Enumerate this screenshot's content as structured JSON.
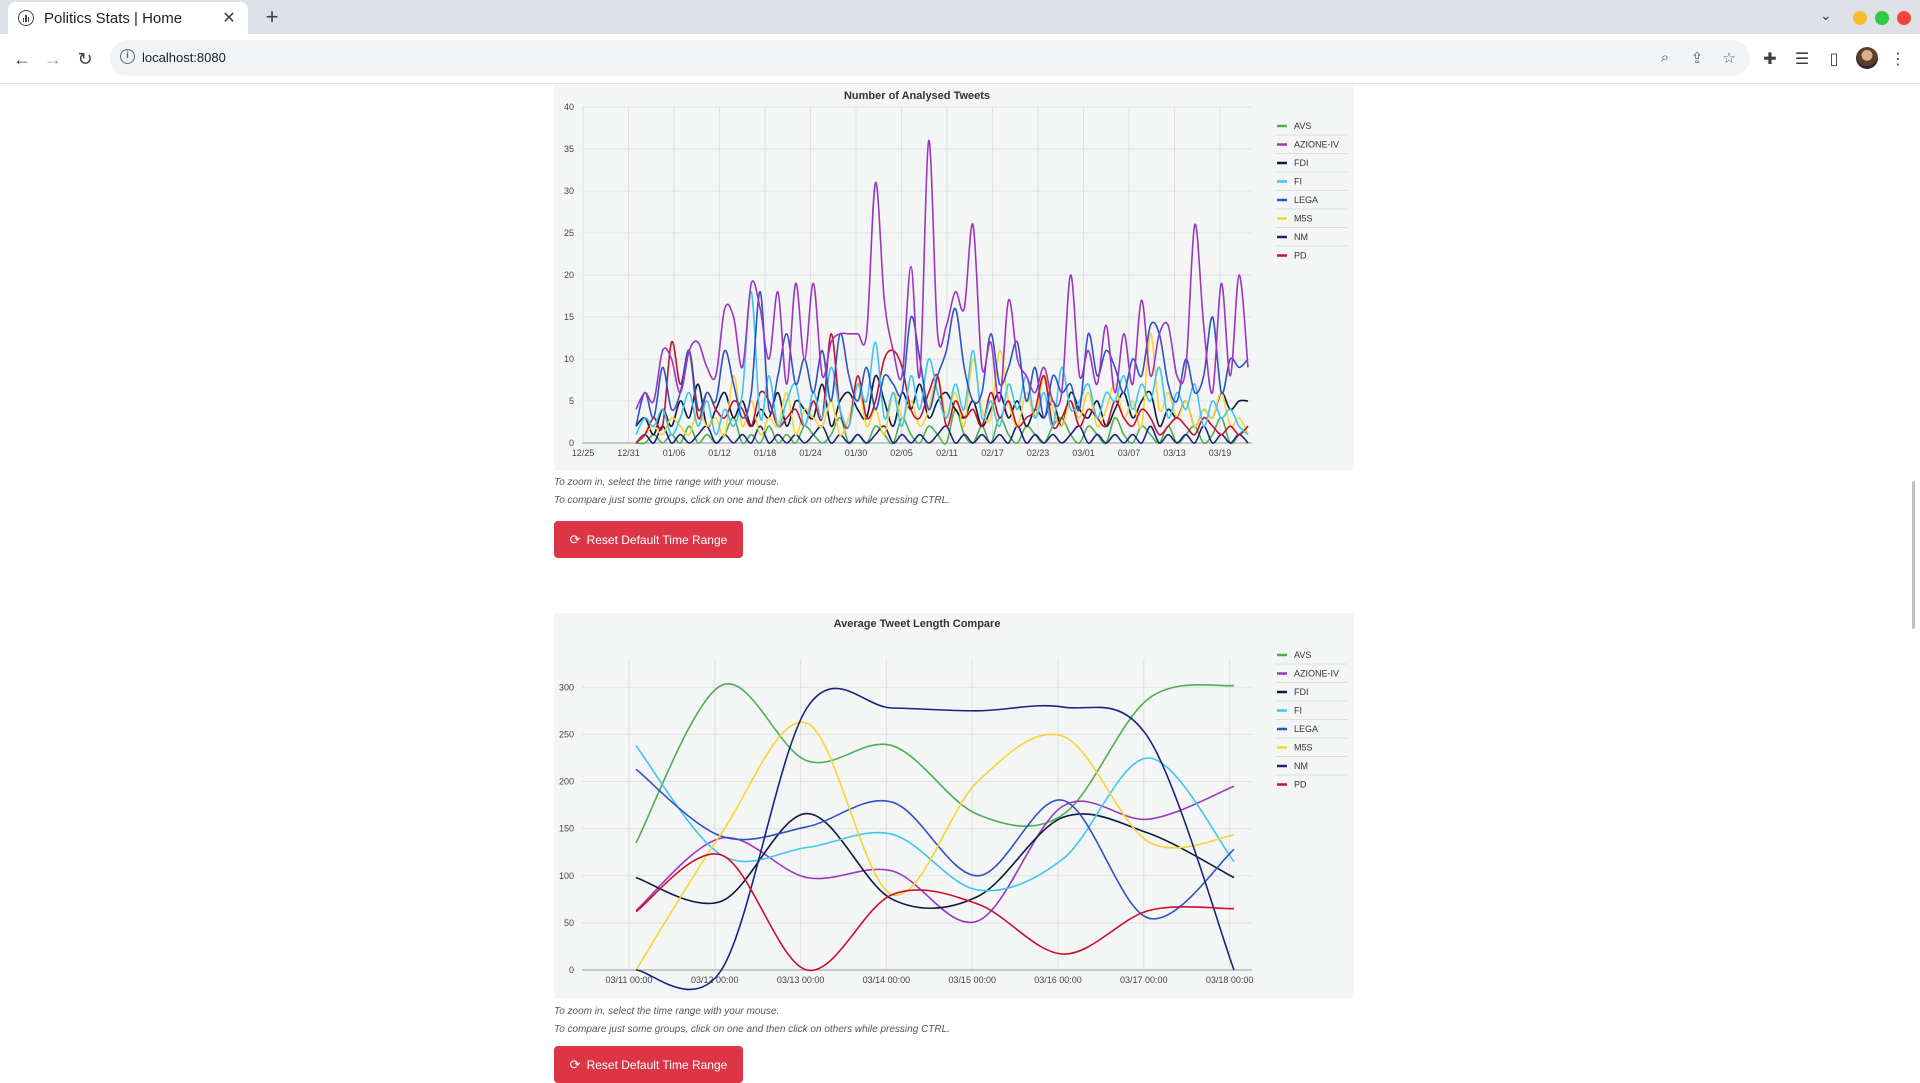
{
  "browser": {
    "tab_title": "Politics Stats | Home",
    "new_tab": "+",
    "url": "localhost:8080"
  },
  "colors": {
    "AVS": "#4caf50",
    "AZIONE-IV": "#9c36c0",
    "FDI": "#0d1b3e",
    "FI": "#3ec6f0",
    "LEGA": "#2f52c4",
    "M5S": "#f7d436",
    "NM": "#1a237e",
    "PD": "#c8102e",
    "button": "#dc3545"
  },
  "hints": {
    "zoom": "To zoom in, select the time range with your mouse.",
    "compare": "To compare just some groups, click on one and then click on others while pressing CTRL."
  },
  "reset_button": {
    "label": "Reset Default Time Range",
    "icon": "refresh-icon"
  },
  "chart_data": [
    {
      "type": "line",
      "title": "Number of Analysed Tweets",
      "xlabel": "",
      "ylabel": "",
      "x_ticks": [
        "12/25",
        "12/31",
        "01/06",
        "01/12",
        "01/18",
        "01/24",
        "01/30",
        "02/05",
        "02/11",
        "02/17",
        "02/23",
        "03/01",
        "03/07",
        "03/13",
        "03/19"
      ],
      "y_ticks": [
        0,
        5,
        10,
        15,
        20,
        25,
        30,
        35,
        40
      ],
      "ylim": [
        0,
        40
      ],
      "x_range": [
        "12/25",
        "03/23"
      ],
      "grid": true,
      "legend": "right",
      "series": [
        {
          "name": "AZIONE-IV",
          "values": [
            4,
            6,
            5,
            11,
            10,
            6,
            11,
            12,
            9,
            8,
            16,
            15,
            9,
            19,
            16,
            10,
            18,
            7,
            19,
            10,
            19,
            8,
            12,
            13,
            13,
            13,
            13,
            31,
            17,
            11,
            8,
            21,
            8,
            36,
            13,
            14,
            18,
            16,
            26,
            9,
            12,
            5,
            17,
            10,
            8,
            6,
            9,
            5,
            6,
            20,
            8,
            11,
            7,
            14,
            6,
            13,
            7,
            17,
            8,
            13,
            14,
            8,
            9,
            26,
            14,
            6,
            19,
            8,
            20,
            9
          ]
        },
        {
          "name": "LEGA",
          "values": [
            2,
            6,
            3,
            9,
            4,
            6,
            11,
            4,
            6,
            5,
            11,
            7,
            3,
            6,
            18,
            4,
            8,
            13,
            7,
            10,
            6,
            11,
            5,
            13,
            8,
            5,
            9,
            4,
            8,
            7,
            6,
            15,
            10,
            4,
            8,
            11,
            16,
            9,
            5,
            6,
            13,
            7,
            9,
            12,
            5,
            9,
            3,
            8,
            6,
            7,
            4,
            13,
            8,
            11,
            9,
            6,
            10,
            8,
            14,
            13,
            7,
            5,
            10,
            6,
            8,
            15,
            6,
            10,
            9,
            10
          ]
        },
        {
          "name": "FI",
          "values": [
            1,
            3,
            2,
            4,
            1,
            3,
            6,
            2,
            5,
            1,
            4,
            2,
            6,
            18,
            3,
            8,
            2,
            5,
            7,
            2,
            6,
            3,
            9,
            4,
            2,
            7,
            5,
            12,
            3,
            6,
            2,
            8,
            4,
            10,
            6,
            3,
            7,
            4,
            11,
            3,
            5,
            2,
            7,
            4,
            8,
            3,
            6,
            2,
            9,
            4,
            5,
            7,
            3,
            6,
            5,
            8,
            4,
            7,
            5,
            9,
            3,
            6,
            4,
            7,
            2,
            5,
            3,
            4,
            2,
            1
          ]
        },
        {
          "name": "M5S",
          "values": [
            0,
            1,
            2,
            1,
            3,
            2,
            1,
            4,
            2,
            3,
            1,
            8,
            2,
            5,
            1,
            3,
            2,
            6,
            1,
            4,
            3,
            2,
            5,
            1,
            3,
            7,
            2,
            4,
            1,
            6,
            3,
            5,
            2,
            4,
            8,
            3,
            6,
            2,
            10,
            4,
            3,
            11,
            5,
            2,
            6,
            3,
            8,
            4,
            2,
            5,
            3,
            6,
            2,
            4,
            7,
            3,
            5,
            2,
            13,
            4,
            6,
            3,
            5,
            2,
            4,
            3,
            6,
            2,
            3,
            1
          ]
        },
        {
          "name": "PD",
          "values": [
            0,
            1,
            3,
            2,
            12,
            7,
            11,
            3,
            6,
            4,
            3,
            5,
            4,
            2,
            6,
            5,
            2,
            3,
            4,
            2,
            5,
            3,
            13,
            4,
            2,
            8,
            3,
            5,
            10,
            11,
            9,
            4,
            3,
            6,
            8,
            2,
            5,
            3,
            4,
            2,
            6,
            3,
            5,
            2,
            3,
            4,
            8,
            2,
            3,
            5,
            2,
            4,
            3,
            2,
            5,
            3,
            2,
            4,
            3,
            1,
            2,
            3,
            2,
            1,
            3,
            2,
            1,
            2,
            1,
            2
          ]
        },
        {
          "name": "FDI",
          "values": [
            2,
            3,
            1,
            4,
            2,
            5,
            3,
            7,
            2,
            4,
            6,
            3,
            5,
            2,
            4,
            3,
            6,
            2,
            5,
            4,
            3,
            7,
            2,
            5,
            6,
            4,
            3,
            8,
            5,
            2,
            6,
            4,
            7,
            3,
            5,
            6,
            4,
            3,
            5,
            2,
            4,
            6,
            3,
            5,
            2,
            4,
            3,
            5,
            2,
            6,
            4,
            3,
            5,
            2,
            4,
            6,
            3,
            5,
            6,
            2,
            4,
            3,
            5,
            2,
            4,
            3,
            6,
            4,
            5,
            5
          ]
        },
        {
          "name": "NM",
          "values": [
            0,
            1,
            0,
            2,
            0,
            1,
            0,
            1,
            2,
            0,
            1,
            0,
            1,
            0,
            2,
            0,
            1,
            0,
            1,
            0,
            1,
            2,
            0,
            1,
            0,
            1,
            0,
            1,
            2,
            0,
            1,
            0,
            1,
            0,
            1,
            2,
            0,
            1,
            0,
            1,
            0,
            1,
            0,
            2,
            0,
            1,
            0,
            1,
            0,
            1,
            2,
            0,
            1,
            0,
            1,
            0,
            1,
            0,
            2,
            0,
            1,
            0,
            1,
            0,
            2,
            0,
            1,
            0,
            1,
            0
          ]
        },
        {
          "name": "AVS",
          "values": [
            0,
            0,
            1,
            0,
            1,
            0,
            2,
            0,
            1,
            0,
            1,
            3,
            0,
            1,
            0,
            2,
            0,
            1,
            0,
            2,
            1,
            0,
            1,
            3,
            0,
            1,
            0,
            2,
            1,
            0,
            3,
            1,
            0,
            2,
            1,
            0,
            4,
            1,
            0,
            2,
            0,
            3,
            1,
            0,
            2,
            1,
            0,
            2,
            3,
            1,
            0,
            2,
            1,
            0,
            3,
            1,
            0,
            2,
            1,
            0,
            2,
            0,
            1,
            2,
            0,
            1,
            3,
            0,
            1,
            2
          ]
        }
      ]
    },
    {
      "type": "line",
      "title": "Average Tweet Length Compare",
      "xlabel": "",
      "ylabel": "",
      "categories": [
        "03/11 00:00",
        "03/12 00:00",
        "03/13 00:00",
        "03/14 00:00",
        "03/15 00:00",
        "03/16 00:00",
        "03/17 00:00",
        "03/18 00:00"
      ],
      "y_ticks": [
        0,
        50,
        100,
        150,
        200,
        250,
        300
      ],
      "ylim": [
        0,
        330
      ],
      "grid": true,
      "legend": "right",
      "series": [
        {
          "name": "AVS",
          "values": [
            135,
            302,
            222,
            238,
            165,
            165,
            288,
            302
          ]
        },
        {
          "name": "AZIONE-IV",
          "values": [
            63,
            140,
            98,
            105,
            52,
            174,
            160,
            195
          ]
        },
        {
          "name": "FDI",
          "values": [
            98,
            73,
            166,
            75,
            78,
            162,
            145,
            98
          ]
        },
        {
          "name": "FI",
          "values": [
            238,
            122,
            130,
            144,
            85,
            118,
            225,
            115
          ]
        },
        {
          "name": "LEGA",
          "values": [
            213,
            142,
            152,
            178,
            100,
            180,
            55,
            128
          ]
        },
        {
          "name": "M5S",
          "values": [
            0,
            145,
            262,
            80,
            200,
            248,
            136,
            143
          ]
        },
        {
          "name": "NM",
          "values": [
            0,
            0,
            278,
            278,
            275,
            279,
            246,
            0
          ]
        },
        {
          "name": "PD",
          "values": [
            62,
            122,
            0,
            80,
            70,
            17,
            63,
            65
          ]
        }
      ]
    }
  ]
}
